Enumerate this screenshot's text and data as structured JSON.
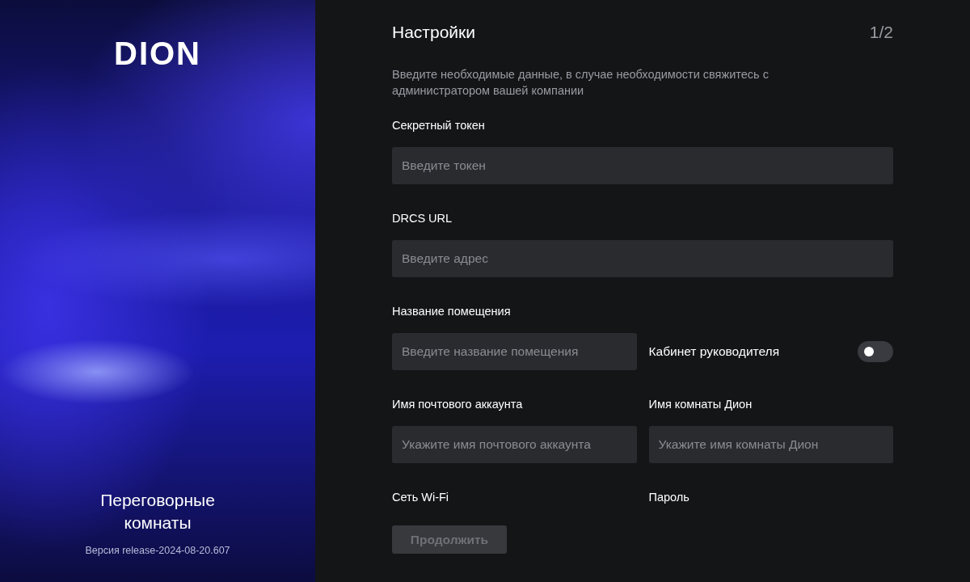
{
  "sidebar": {
    "logo": "DION",
    "title": "Переговорные комнаты",
    "version": "Версия release-2024-08-20.607"
  },
  "header": {
    "title": "Настройки",
    "step": "1/2"
  },
  "description": "Введите необходимые данные, в случае необходимости свяжитесь с администратором вашей компании",
  "form_rows": [
    {
      "cells": [
        {
          "kind": "input",
          "label": "Секретный токен",
          "placeholder": "Введите токен"
        }
      ]
    },
    {
      "cells": [
        {
          "kind": "input",
          "label": "DRCS URL",
          "placeholder": "Введите адрес"
        }
      ]
    },
    {
      "cells": [
        {
          "kind": "input",
          "label": "Название помещения",
          "placeholder": "Введите название помещения"
        },
        {
          "kind": "toggle",
          "label": "Кабинет руководителя",
          "on": false
        }
      ]
    },
    {
      "cells": [
        {
          "kind": "input",
          "label": "Имя почтового аккаунта",
          "placeholder": "Укажите имя почтового аккаунта"
        },
        {
          "kind": "input",
          "label": "Имя комнаты Дион",
          "placeholder": "Укажите имя комнаты Дион"
        }
      ]
    },
    {
      "cells": [
        {
          "kind": "label",
          "label": "Сеть Wi-Fi"
        },
        {
          "kind": "label",
          "label": "Пароль"
        }
      ]
    }
  ],
  "button": {
    "label": "Продолжить",
    "disabled": true
  }
}
